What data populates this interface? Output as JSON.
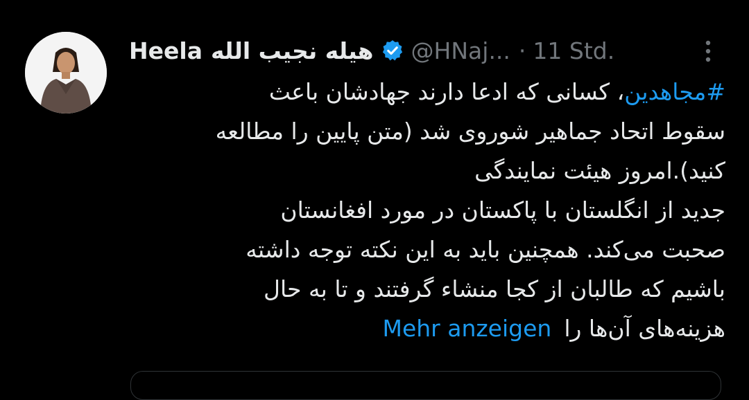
{
  "tweet": {
    "display_name_latin": "Heela",
    "display_name_persian": "هیله نجیب الله",
    "handle": "@HNaj...",
    "separator": "·",
    "timestamp": "11 Std.",
    "hashtag": "#مجاهدین",
    "lines": [
      "، کسانی که ادعا دارند جهادشان باعث",
      "سقوط اتحاد جماهیر شوروی شد (متن پایین را مطالعه",
      "کنید).امروز هیئت نمایندگی",
      "جدید از انگلستان با پاکستان در مورد افغانستان",
      "صحبت می‌کند. همچنین باید به این نکته توجه داشته",
      "باشیم که طالبان از کجا منشاء گرفتند و تا به حال",
      "هزینه‌های آن‌ها را"
    ],
    "show_more": "Mehr anzeigen"
  },
  "icons": {
    "verified": "verified-badge-icon",
    "more": "more-options-icon"
  },
  "colors": {
    "background": "#000000",
    "text": "#e7e9ea",
    "secondary": "#71767b",
    "accent": "#1d9bf0"
  }
}
